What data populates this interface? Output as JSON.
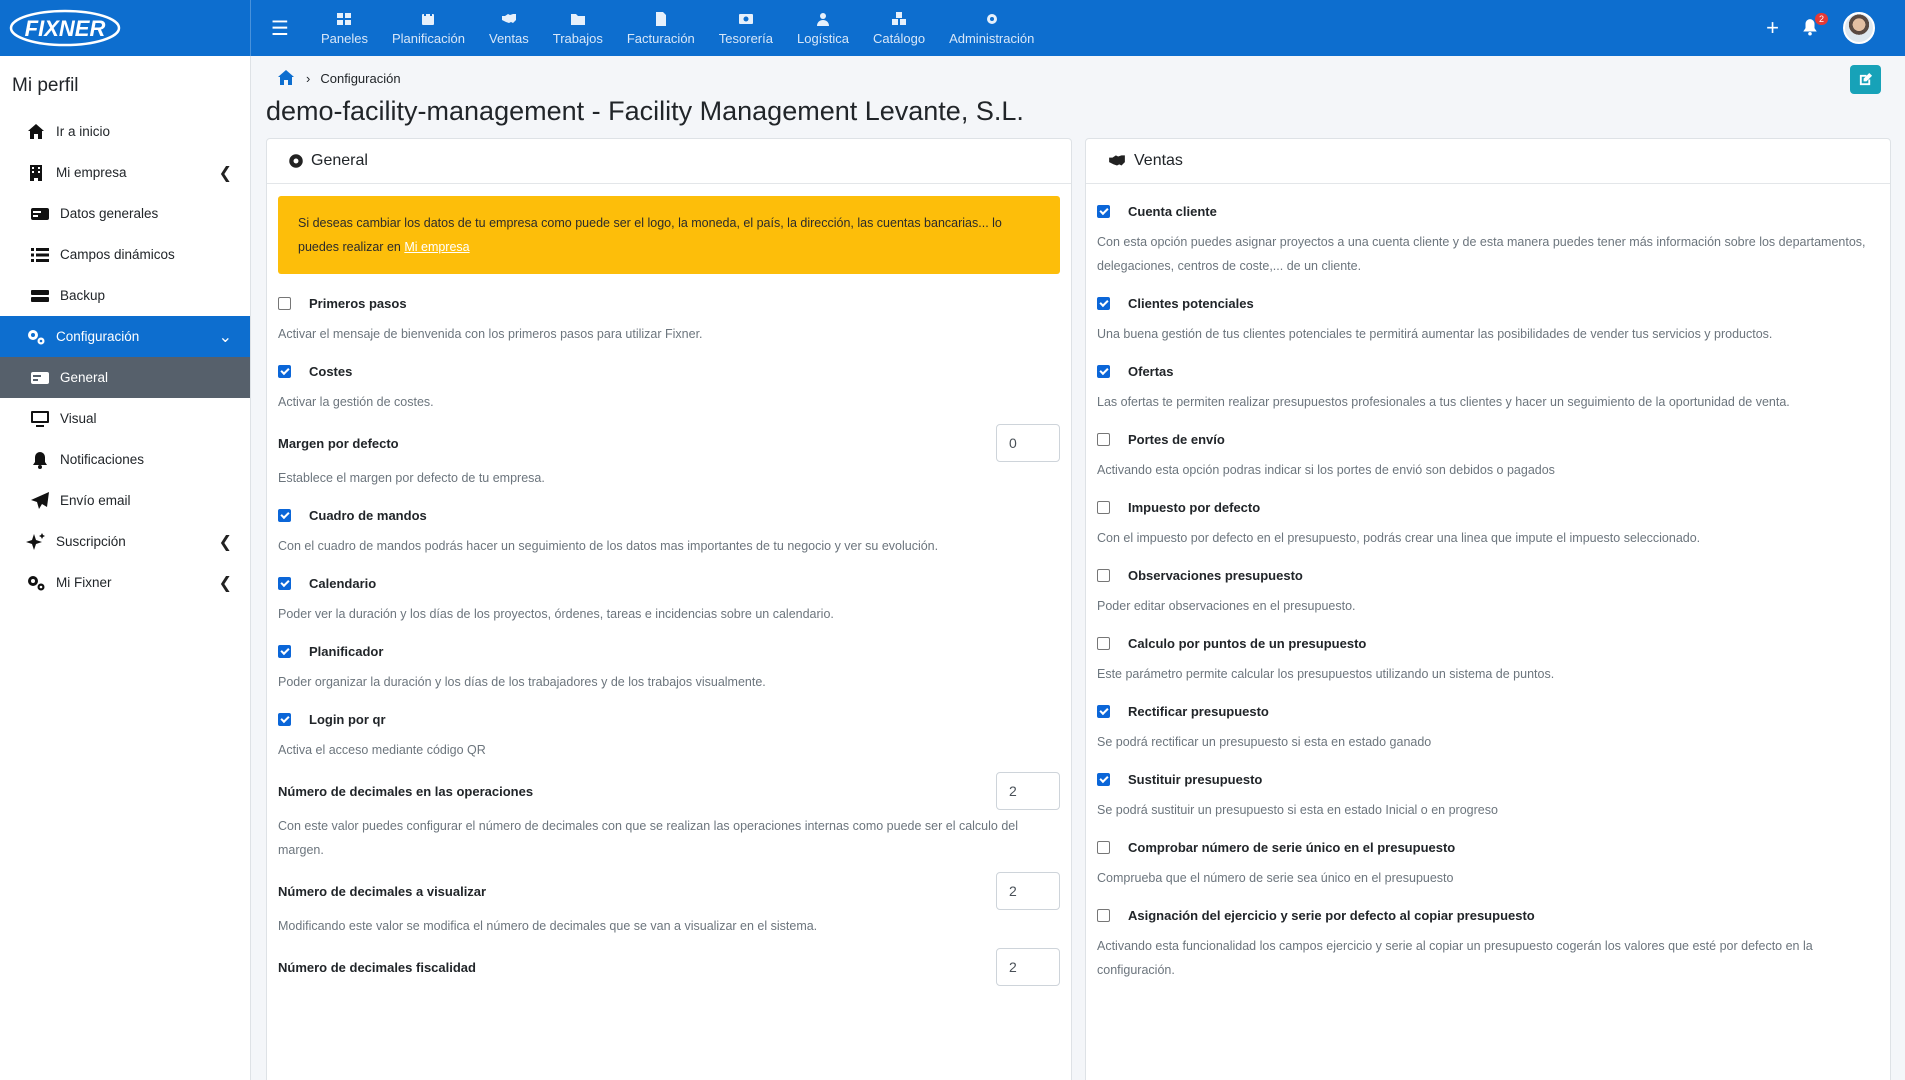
{
  "brand": {
    "logo_text": "FIXNER"
  },
  "topnav": {
    "items": [
      {
        "label": "Paneles"
      },
      {
        "label": "Planificación"
      },
      {
        "label": "Ventas"
      },
      {
        "label": "Trabajos"
      },
      {
        "label": "Facturación"
      },
      {
        "label": "Tesorería"
      },
      {
        "label": "Logística"
      },
      {
        "label": "Catálogo"
      },
      {
        "label": "Administración"
      }
    ],
    "plus": "+",
    "notifications_count": "2"
  },
  "sidebar": {
    "title": "Mi perfil",
    "items": [
      {
        "label": "Ir a inicio"
      },
      {
        "label": "Mi empresa"
      },
      {
        "label": "Datos generales"
      },
      {
        "label": "Campos dinámicos"
      },
      {
        "label": "Backup"
      },
      {
        "label": "Configuración"
      },
      {
        "label": "General"
      },
      {
        "label": "Visual"
      },
      {
        "label": "Notificaciones"
      },
      {
        "label": "Envío email"
      },
      {
        "label": "Suscripción"
      },
      {
        "label": "Mi Fixner"
      }
    ]
  },
  "breadcrumb": {
    "current": "Configuración"
  },
  "page": {
    "title": "demo-facility-management - Facility Management Levante, S.L."
  },
  "general": {
    "header": "General",
    "alert_text": "Si deseas cambiar los datos de tu empresa como puede ser el logo, la moneda, el país, la dirección, las cuentas bancarias... lo puedes realizar en ",
    "alert_link": "Mi empresa",
    "options": [
      {
        "label": "Primeros pasos",
        "desc": "Activar el mensaje de bienvenida con los primeros pasos para utilizar Fixner."
      },
      {
        "label": "Costes",
        "desc": "Activar la gestión de costes."
      },
      {
        "label": "Margen por defecto",
        "desc": "Establece el margen por defecto de tu empresa.",
        "value": "0"
      },
      {
        "label": "Cuadro de mandos",
        "desc": "Con el cuadro de mandos podrás hacer un seguimiento de los datos mas importantes de tu negocio y ver su evolución."
      },
      {
        "label": "Calendario",
        "desc": "Poder ver la duración y los días de los proyectos, órdenes, tareas e incidencias sobre un calendario."
      },
      {
        "label": "Planificador",
        "desc": "Poder organizar la duración y los días de los trabajadores y de los trabajos visualmente."
      },
      {
        "label": "Login por qr",
        "desc": "Activa el acceso mediante código QR"
      },
      {
        "label": "Número de decimales en las operaciones",
        "desc": "Con este valor puedes configurar el número de decimales con que se realizan las operaciones internas como puede ser el calculo del margen.",
        "value": "2"
      },
      {
        "label": "Número de decimales a visualizar",
        "desc": "Modificando este valor se modifica el número de decimales que se van a visualizar en el sistema.",
        "value": "2"
      },
      {
        "label": "Número de decimales fiscalidad",
        "value": "2"
      }
    ]
  },
  "ventas": {
    "header": "Ventas",
    "options": [
      {
        "label": "Cuenta cliente",
        "desc": "Con esta opción puedes asignar proyectos a una cuenta cliente y de esta manera puedes tener más información sobre los departamentos, delegaciones, centros de coste,... de un cliente."
      },
      {
        "label": "Clientes potenciales",
        "desc": "Una buena gestión de tus clientes potenciales te permitirá aumentar las posibilidades de vender tus servicios y productos."
      },
      {
        "label": "Ofertas",
        "desc": "Las ofertas te permiten realizar presupuestos profesionales a tus clientes y hacer un seguimiento de la oportunidad de venta."
      },
      {
        "label": "Portes de envío",
        "desc": "Activando esta opción podras indicar si los portes de envió son debidos o pagados"
      },
      {
        "label": "Impuesto por defecto",
        "desc": "Con el impuesto por defecto en el presupuesto, podrás crear una linea que impute el impuesto seleccionado."
      },
      {
        "label": "Observaciones presupuesto",
        "desc": "Poder editar observaciones en el presupuesto."
      },
      {
        "label": "Calculo por puntos de un presupuesto",
        "desc": "Este parámetro permite calcular los presupuestos utilizando un sistema de puntos."
      },
      {
        "label": "Rectificar presupuesto",
        "desc": "Se podrá rectificar un presupuesto si esta en estado ganado"
      },
      {
        "label": "Sustituir presupuesto",
        "desc": "Se podrá sustituir un presupuesto si esta en estado Inicial o en progreso"
      },
      {
        "label": "Comprobar número de serie único en el presupuesto",
        "desc": "Comprueba que el número de serie sea único en el presupuesto"
      },
      {
        "label": "Asignación del ejercicio y serie por defecto al copiar presupuesto",
        "desc": "Activando esta funcionalidad los campos ejercicio y serie al copiar un presupuesto cogerán los valores que esté por defecto en la configuración."
      }
    ]
  },
  "colors": {
    "primary": "#0d6ecf",
    "alert": "#fdbe0a",
    "current": "#56606b",
    "edit": "#17a2b8"
  }
}
